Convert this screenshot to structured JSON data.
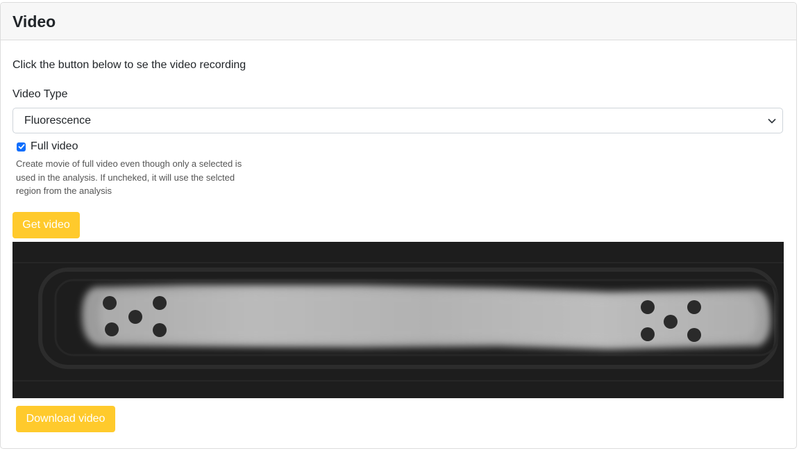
{
  "card": {
    "title": "Video",
    "intro": "Click the button below to se the video recording"
  },
  "form": {
    "video_type_label": "Video Type",
    "video_type_selected": "Fluorescence",
    "full_video_label": "Full video",
    "full_video_checked": true,
    "help_text": "Create movie of full video even though only a selected is used in the analysis. If uncheked, it will use the selcted region from the analysis"
  },
  "buttons": {
    "get_video": "Get video",
    "download_video": "Download video"
  },
  "icons": {
    "select_arrow": "chevron-down-icon",
    "checkbox": "check-icon"
  },
  "colors": {
    "button_bg": "#ffca2c",
    "checkbox_bg": "#0d6efd",
    "video_bg": "#1d1d1d"
  }
}
